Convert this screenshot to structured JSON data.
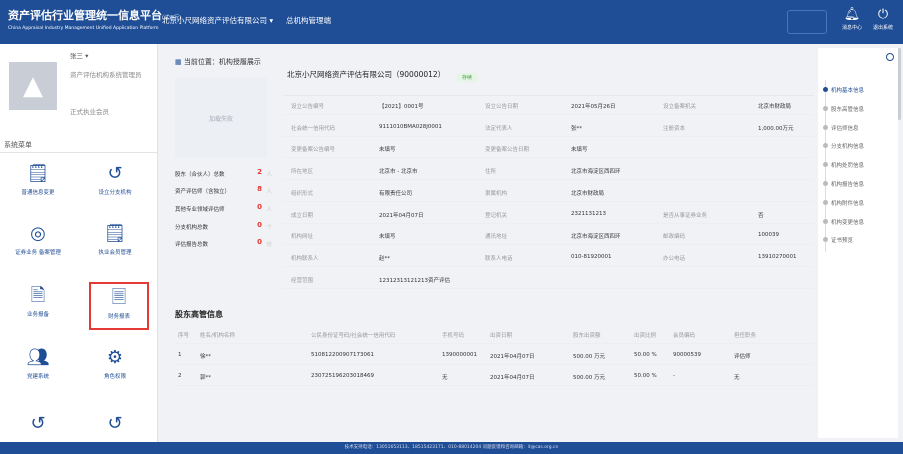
{
  "header": {
    "title": "资产评估行业管理统一信息平台",
    "title_tag": "(试运行)",
    "subtitle": "China Appraisal Industry Management Unified Application Platform",
    "company": "北京小尺网络资产评估有限公司 ▾",
    "org_mgmt": "总机构管理端",
    "msg_label": "消息中心",
    "exit_label": "退出系统",
    "msg_icon": "bell-icon",
    "exit_icon": "power-icon"
  },
  "user": {
    "name": "张三 ▾",
    "role": "资产评估机构系统管理员",
    "member": "正式执业会员"
  },
  "menu": {
    "title": "系统菜单",
    "items": [
      {
        "label": "普通信息变更",
        "icon": "form-edit-icon"
      },
      {
        "label": "设立分支机构",
        "icon": "history-icon"
      },
      {
        "label": "证券业务 备案管理",
        "icon": "target-icon"
      },
      {
        "label": "执业会员管理",
        "icon": "form-edit-icon"
      },
      {
        "label": "业务报备",
        "icon": "report-icon"
      },
      {
        "label": "财务报表",
        "icon": "financial-report-icon"
      },
      {
        "label": "党建系统",
        "icon": "people-icon"
      },
      {
        "label": "角色权限",
        "icon": "settings-icon"
      },
      {
        "label": "",
        "icon": "history-icon"
      },
      {
        "label": "",
        "icon": "history-icon"
      }
    ]
  },
  "breadcrumb": {
    "prefix": "当前位置：",
    "current": "机构授履展示"
  },
  "photo_placeholder": "加载失败",
  "counts": [
    {
      "label": "股东（合伙人）总数",
      "value": "2",
      "unit": "人"
    },
    {
      "label": "资产评估师（含独立）",
      "value": "8",
      "unit": "人"
    },
    {
      "label": "其他专业领域评估师",
      "value": "0",
      "unit": "人"
    },
    {
      "label": "分支机构总数",
      "value": "0",
      "unit": "个"
    },
    {
      "label": "评估报告总数",
      "value": "0",
      "unit": "份"
    }
  ],
  "company": {
    "title": "北京小尺网络资产评估有限公司（90000012）",
    "status": "存续"
  },
  "info_rows": [
    [
      "设立公告编号",
      "【2021】0001号",
      "设立公告日期",
      "2021年05月26日",
      "设立备案机关",
      "北京市财政局"
    ],
    [
      "社会统一信用代码",
      "9111010BMA028J0001",
      "法定代表人",
      "张**",
      "注册资本",
      "1,000.00万元"
    ],
    [
      "变更备案公告编号",
      "未填写",
      "变更备案公告日期",
      "未填写",
      "",
      ""
    ],
    [
      "所在地区",
      "北京市 - 北京市",
      "住所",
      "北京市海淀区西四环",
      "",
      ""
    ],
    [
      "组织形式",
      "有限责任公司",
      "隶属机构",
      "北京市财政局",
      "",
      ""
    ],
    [
      "成立日期",
      "2021年04月07日",
      "登记机关",
      "2321131213",
      "是否从事证券业务",
      "否"
    ],
    [
      "机构网址",
      "未填写",
      "通讯地址",
      "北京市海淀区西四环",
      "邮政编码",
      "100039"
    ],
    [
      "机构联系人",
      "赵**",
      "联系人电话",
      "010-81920001",
      "办公电话",
      "13910270001"
    ],
    [
      "经营范围",
      "12312313121213资产评估",
      "",
      "",
      "",
      ""
    ]
  ],
  "shareholders": {
    "title": "股东高管信息",
    "headers": [
      "序号",
      "姓名/机构名称",
      "公民身份证号码/社会统一信用代码",
      "手机号码",
      "出资日期",
      "股东出资额",
      "出资比例",
      "会员编码",
      "担任职务"
    ],
    "rows": [
      [
        "1",
        "徐**",
        "510812200907173061",
        "1390000001",
        "2021年04月07日",
        "500.00 万元",
        "50.00 %",
        "90000539",
        "评估师"
      ],
      [
        "2",
        "郭**",
        "230725196203018469",
        "无",
        "2021年04月07日",
        "500.00 万元",
        "50.00 %",
        "-",
        "无"
      ]
    ]
  },
  "right_nav": {
    "items": [
      "机构基本信息",
      "股东高管信息",
      "评估师信息",
      "分支机构信息",
      "机构处罚信息",
      "机构报告信息",
      "机构附件信息",
      "机构变更信息",
      "证书预览"
    ]
  },
  "footer": "技术支持电话：13051653113、18515423171、010-88014204 问题反馈和咨询邮箱：it@cas.org.cn"
}
